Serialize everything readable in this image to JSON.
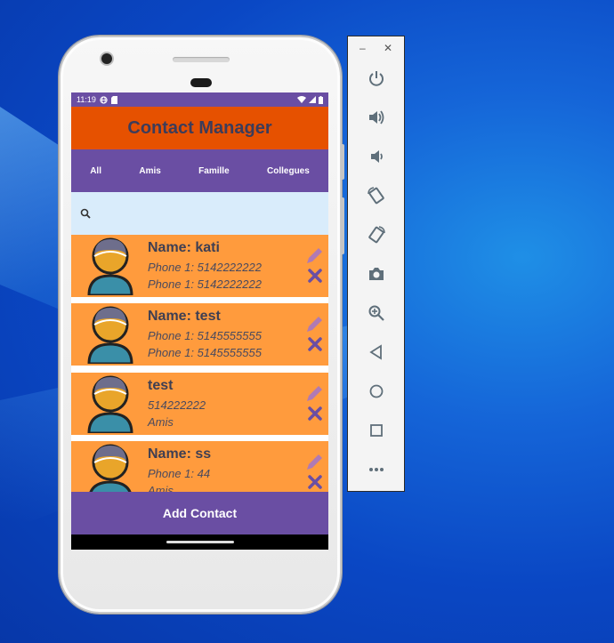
{
  "status": {
    "time": "11:19"
  },
  "app": {
    "title": "Contact Manager"
  },
  "tabs": [
    "All",
    "Amis",
    "Famille",
    "Collegues"
  ],
  "contacts": [
    {
      "line1": "Name: kati",
      "line2": "Phone 1:  5142222222",
      "line3": "Phone 1:  5142222222"
    },
    {
      "line1": "Name: test",
      "line2": "Phone 1:  5145555555",
      "line3": "Phone 1:  5145555555"
    },
    {
      "line1": "test",
      "line2": "514222222",
      "line3": "Amis"
    },
    {
      "line1": "Name: ss",
      "line2": "Phone 1:  44",
      "line3": "Amis"
    }
  ],
  "add_button": "Add Contact",
  "toolbar": {
    "minimize": "–",
    "close": "✕",
    "buttons": [
      "power-icon",
      "volume-up-icon",
      "volume-down-icon",
      "rotate-left-icon",
      "rotate-right-icon",
      "camera-icon",
      "zoom-icon",
      "back-icon",
      "home-icon",
      "overview-icon",
      "more-icon"
    ]
  },
  "colors": {
    "accent_purple": "#6a4ea3",
    "appbar_orange": "#e65100",
    "card_orange": "#ff9b3d",
    "search_bg": "#d9ecfb"
  }
}
